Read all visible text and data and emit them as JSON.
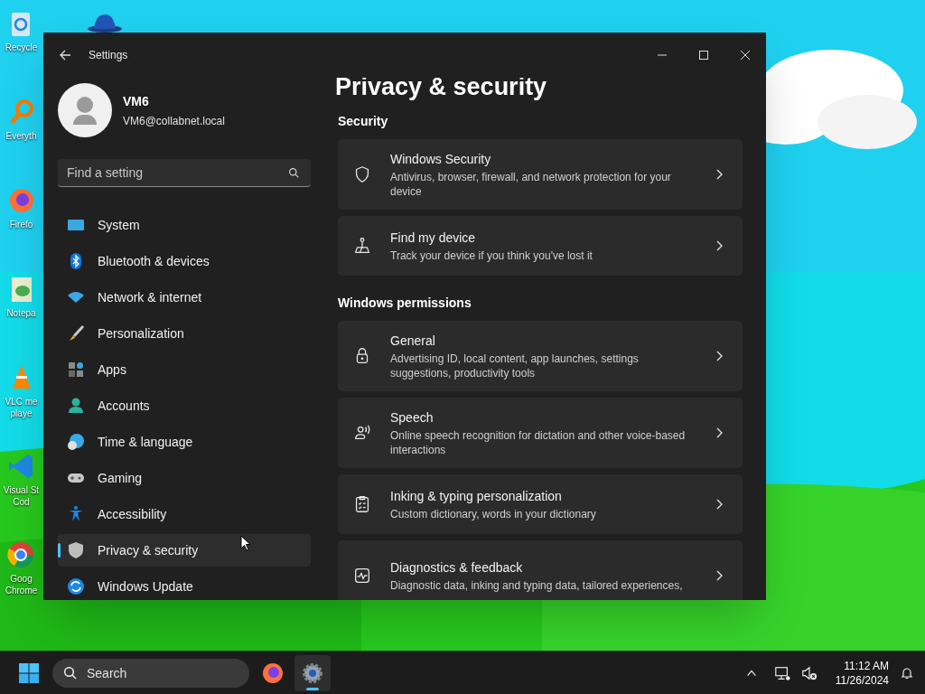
{
  "desktop": {
    "icons": [
      {
        "label": "Recycle"
      },
      {
        "label": "Everyth"
      },
      {
        "label": "Firefo"
      },
      {
        "label": "Notepa"
      },
      {
        "label": "VLC me\nplaye"
      },
      {
        "label": "Visual St\nCod"
      },
      {
        "label": "Goog\nChrome"
      }
    ]
  },
  "window": {
    "title": "Settings"
  },
  "profile": {
    "name": "VM6",
    "email": "VM6@collabnet.local"
  },
  "search": {
    "placeholder": "Find a setting"
  },
  "sidebar": {
    "items": [
      {
        "label": "System",
        "selected": false
      },
      {
        "label": "Bluetooth & devices",
        "selected": false
      },
      {
        "label": "Network & internet",
        "selected": false
      },
      {
        "label": "Personalization",
        "selected": false
      },
      {
        "label": "Apps",
        "selected": false
      },
      {
        "label": "Accounts",
        "selected": false
      },
      {
        "label": "Time & language",
        "selected": false
      },
      {
        "label": "Gaming",
        "selected": false
      },
      {
        "label": "Accessibility",
        "selected": false
      },
      {
        "label": "Privacy & security",
        "selected": true
      },
      {
        "label": "Windows Update",
        "selected": false
      }
    ]
  },
  "page": {
    "title": "Privacy & security",
    "sections": [
      {
        "title": "Security",
        "items": [
          {
            "kind": "shield",
            "title": "Windows Security",
            "description": "Antivirus, browser, firewall, and network protection for your device"
          },
          {
            "kind": "locate",
            "title": "Find my device",
            "description": "Track your device if you think you've lost it"
          }
        ]
      },
      {
        "title": "Windows permissions",
        "items": [
          {
            "kind": "lock",
            "title": "General",
            "description": "Advertising ID, local content, app launches, settings suggestions, productivity tools"
          },
          {
            "kind": "speech",
            "title": "Speech",
            "description": "Online speech recognition for dictation and other voice-based interactions"
          },
          {
            "kind": "clipboard",
            "title": "Inking & typing personalization",
            "description": "Custom dictionary, words in your dictionary"
          },
          {
            "kind": "pulse",
            "title": "Diagnostics & feedback",
            "description": "Diagnostic data, inking and typing data, tailored experiences,"
          }
        ]
      }
    ]
  },
  "taskbar": {
    "search": {
      "placeholder": "Search"
    },
    "apps": [
      {
        "selected": false
      },
      {
        "selected": true
      }
    ],
    "time": "11:12 AM",
    "date": "11/26/2024"
  }
}
